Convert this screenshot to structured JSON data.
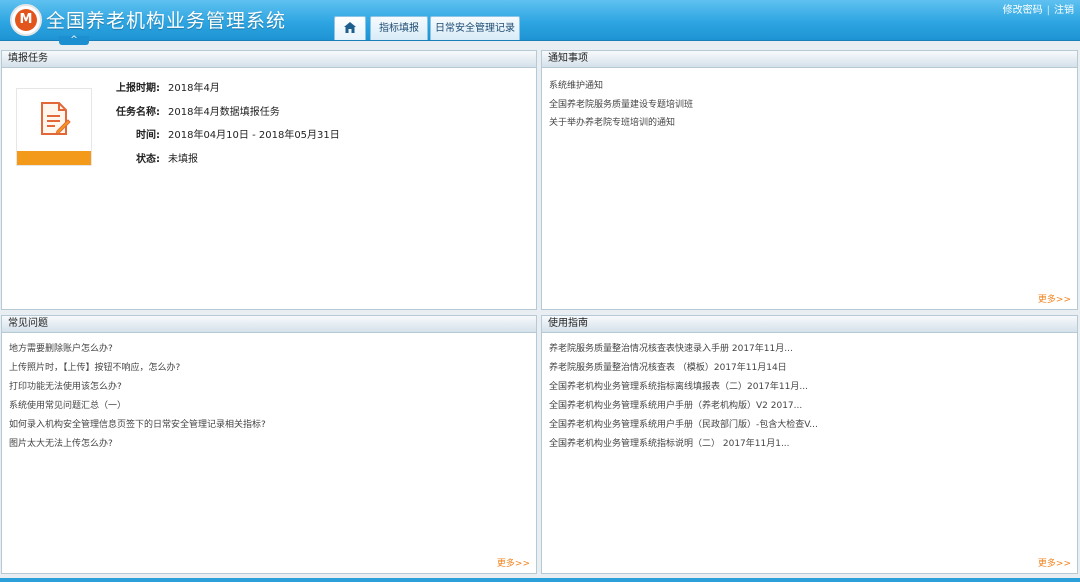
{
  "header": {
    "logo_text": "M",
    "title": "全国养老机构业务管理系统",
    "collapse_glyph": "^",
    "tabs": [
      {
        "label": "",
        "icon": "home-icon"
      },
      {
        "label": "指标填报"
      },
      {
        "label": "日常安全管理记录"
      }
    ],
    "links": {
      "change_password": "修改密码",
      "separator": "|",
      "logout": "注销"
    }
  },
  "task_panel": {
    "title": "填报任务",
    "fields": [
      {
        "label": "上报时期:",
        "value": "2018年4月"
      },
      {
        "label": "任务名称:",
        "value": "2018年4月数据填报任务"
      },
      {
        "label": "时间:",
        "value": "2018年04月10日 - 2018年05月31日"
      },
      {
        "label": "状态:",
        "value": "未填报"
      }
    ],
    "icon": "document-edit-icon",
    "accent": "#f49a1b"
  },
  "notice_panel": {
    "title": "通知事项",
    "items": [
      "系统维护通知",
      "全国养老院服务质量建设专题培训班",
      "关于举办养老院专班培训的通知"
    ],
    "more": "更多>>"
  },
  "faq_panel": {
    "title": "常见问题",
    "items": [
      "地方需要删除账户怎么办?",
      "上传照片时，【上传】按钮不响应，怎么办?",
      "打印功能无法使用该怎么办?",
      "系统使用常见问题汇总（一）",
      "如何录入机构安全管理信息页签下的日常安全管理记录相关指标?",
      "图片太大无法上传怎么办?"
    ],
    "more": "更多>>"
  },
  "guide_panel": {
    "title": "使用指南",
    "items": [
      "养老院服务质量整治情况核查表快速录入手册 2017年11月...",
      "养老院服务质量整治情况核查表 （模板）2017年11月14日",
      "全国养老机构业务管理系统指标离线填报表（二）2017年11月...",
      "全国养老机构业务管理系统用户手册（养老机构版）V2 2017...",
      "全国养老机构业务管理系统用户手册（民政部门版）-包含大检查V...",
      "全国养老机构业务管理系统指标说明（二） 2017年11月1..."
    ],
    "more": "更多>>"
  },
  "colors": {
    "header": "#2ea6e2",
    "accent": "#f0831e"
  }
}
